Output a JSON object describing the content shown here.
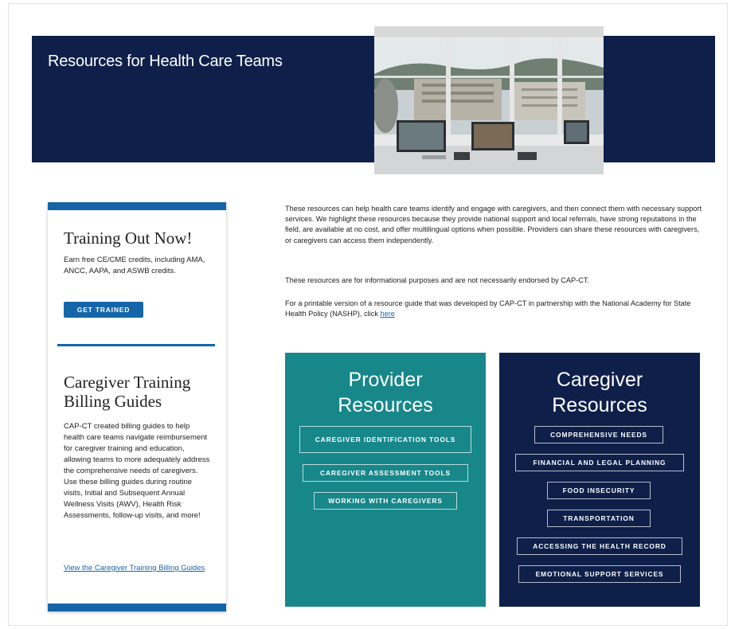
{
  "hero": {
    "title": "Resources for Health Care Teams"
  },
  "sidebar": {
    "training": {
      "heading": "Training Out Now!",
      "text": "Earn free CE/CME credits, including AMA, ANCC, AAPA, and ASWB credits.",
      "button_label": "GET TRAINED"
    },
    "billing": {
      "heading": "Caregiver Training Billing Guides",
      "text": "CAP-CT created billing guides to help health care teams navigate reimbursement for caregiver training and education, allowing teams to more adequately address the comprehensive needs of caregivers. Use these billing guides during routine visits, Initial and Subsequent Annual Wellness Visits (AWV), Health Risk Assessments, follow-up visits, and more!",
      "link": "View the Caregiver Training Billing Guides"
    }
  },
  "intro": {
    "p1": "These resources can help health care teams identify and engage with caregivers, and then connect them with necessary support services. We highlight these resources because they provide national support and local referrals, have strong reputations in the field, are available at no cost, and offer multilingual options when possible. Providers can share these resources with caregivers, or caregivers can access them independently.",
    "p2": "These resources are for informational purposes and are not necessarily endorsed by CAP-CT.",
    "p3": "For a printable version of a resource guide that was developed by CAP-CT in partnership with the National Academy for State Health Policy (NASHP), click ",
    "p3_link": "here"
  },
  "provider": {
    "title_line1": "Provider",
    "title_line2": "Resources",
    "buttons": [
      "CAREGIVER IDENTIFICATION TOOLS",
      "CAREGIVER ASSESSMENT TOOLS",
      "WORKING WITH CAREGIVERS"
    ]
  },
  "caregiver": {
    "title_line1": "Caregiver",
    "title_line2": "Resources",
    "buttons": [
      "COMPREHENSIVE NEEDS",
      "FINANCIAL AND LEGAL PLANNING",
      "FOOD INSECURITY",
      "TRANSPORTATION",
      "ACCESSING THE HEALTH RECORD",
      "EMOTIONAL SUPPORT SERVICES"
    ]
  },
  "colors": {
    "navy": "#0e1f4a",
    "teal": "#17878a",
    "accent_blue": "#1565a6"
  }
}
